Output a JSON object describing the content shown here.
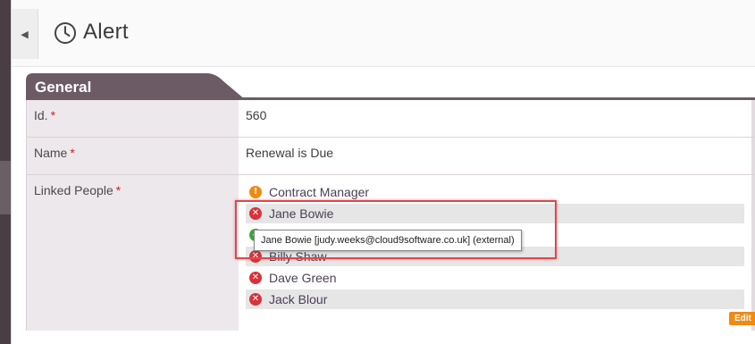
{
  "header": {
    "title": "Alert",
    "collapse_icon": "triangle-left-icon",
    "title_icon": "clock-icon"
  },
  "section": {
    "title": "General"
  },
  "fields": {
    "id": {
      "label": "Id.",
      "required_mark": "*",
      "value": "560"
    },
    "name": {
      "label": "Name",
      "required_mark": "*",
      "value": "Renewal is Due"
    },
    "linked_people": {
      "label": "Linked People",
      "required_mark": "*",
      "people": [
        {
          "name": "Contract Manager",
          "status": "warning",
          "icon": "exclamation-icon"
        },
        {
          "name": "Jane Bowie",
          "status": "error",
          "icon": "x-icon"
        },
        {
          "name": "",
          "status": "success",
          "icon": "check-icon"
        },
        {
          "name": "Billy Shaw",
          "status": "error",
          "icon": "x-icon"
        },
        {
          "name": "Dave Green",
          "status": "error",
          "icon": "x-icon"
        },
        {
          "name": "Jack Blour",
          "status": "error",
          "icon": "x-icon"
        }
      ]
    }
  },
  "tooltip": {
    "text": "Jane Bowie [judy.weeks@cloud9software.co.uk] (external)"
  },
  "edit_button": {
    "label": "Edit"
  },
  "colors": {
    "section_accent": "#6c5b65",
    "error": "#d6343a",
    "warning": "#ef8a12",
    "success": "#3fa33f",
    "required": "#cc2229",
    "highlight": "#e0474c"
  }
}
